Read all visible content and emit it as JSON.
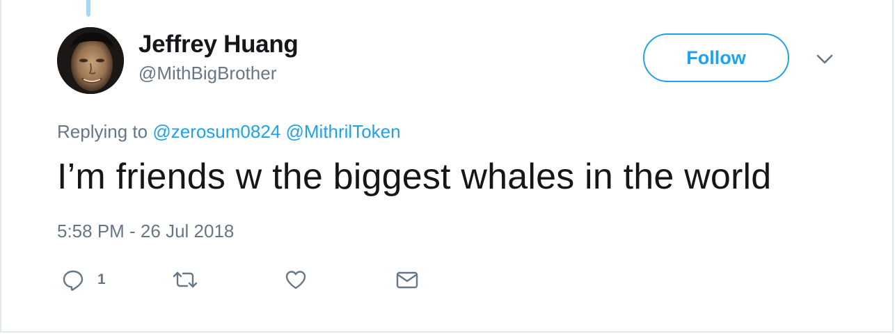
{
  "tweet": {
    "author": {
      "name": "Jeffrey Huang",
      "handle": "@MithBigBrother",
      "avatar_icon": "user-avatar-photo"
    },
    "follow_label": "Follow",
    "caret_icon": "chevron-down-icon",
    "replying": {
      "prefix": "Replying to",
      "mentions": [
        "@zerosum0824",
        "@MithrilToken"
      ]
    },
    "text": "I’m friends w the biggest whales in the world",
    "timestamp": "5:58 PM - 26 Jul 2018",
    "actions": {
      "reply_count": "1",
      "reply_icon": "reply-icon",
      "retweet_icon": "retweet-icon",
      "like_icon": "heart-icon",
      "dm_icon": "envelope-icon"
    }
  },
  "colors": {
    "accent": "#1da1f2",
    "secondary_text": "#657786",
    "primary_text": "#14171a",
    "thread_line": "#a8d7f5"
  }
}
